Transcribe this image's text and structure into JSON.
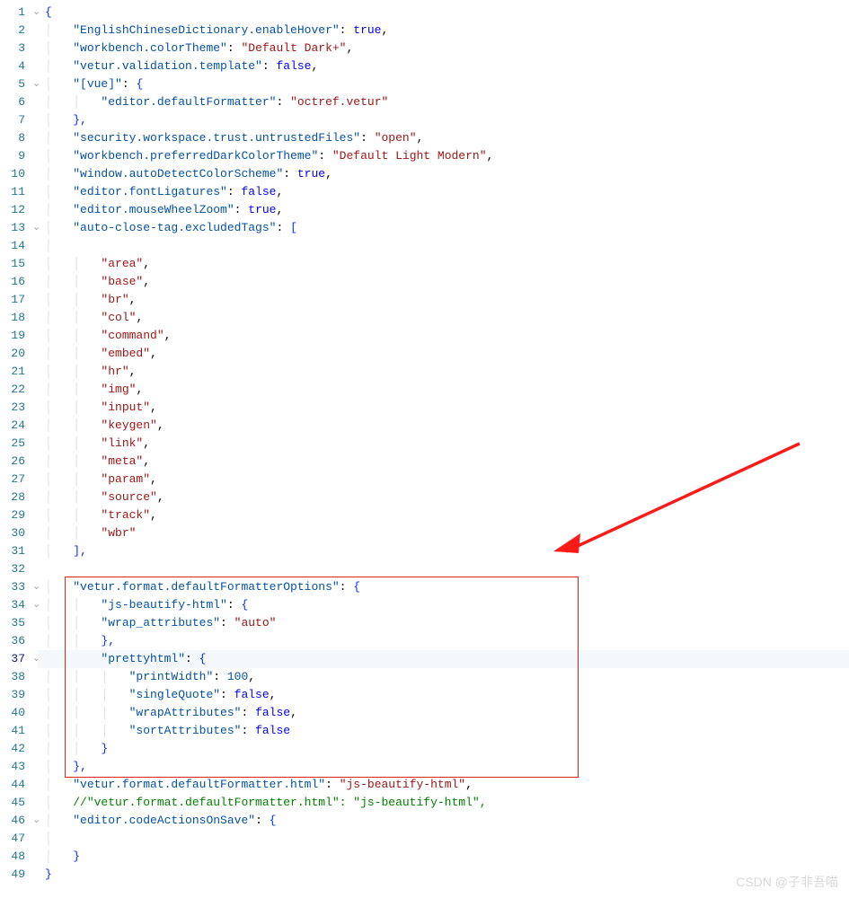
{
  "watermark": "CSDN @子非吾喵",
  "current_line": 37,
  "highlight_box": {
    "startLine": 33,
    "endLine": 43
  },
  "lines": [
    {
      "n": 1,
      "indent": 0,
      "ctype": "brace_open",
      "text": "{"
    },
    {
      "n": 2,
      "indent": 1,
      "ctype": "kv",
      "key": "EnglishChineseDictionary.enableHover",
      "val": "true",
      "vtype": "kw",
      "comma": true
    },
    {
      "n": 3,
      "indent": 1,
      "ctype": "kv",
      "key": "workbench.colorTheme",
      "val": "Default Dark+",
      "vtype": "str",
      "comma": true
    },
    {
      "n": 4,
      "indent": 1,
      "ctype": "kv",
      "key": "vetur.validation.template",
      "val": "false",
      "vtype": "kw",
      "comma": true
    },
    {
      "n": 5,
      "indent": 1,
      "ctype": "kv",
      "key": "[vue]",
      "val": "{",
      "vtype": "brace",
      "comma": false
    },
    {
      "n": 6,
      "indent": 2,
      "ctype": "kv",
      "key": "editor.defaultFormatter",
      "val": "octref.vetur",
      "vtype": "str",
      "comma": false
    },
    {
      "n": 7,
      "indent": 1,
      "ctype": "brace_close",
      "text": "},"
    },
    {
      "n": 8,
      "indent": 1,
      "ctype": "kv",
      "key": "security.workspace.trust.untrustedFiles",
      "val": "open",
      "vtype": "str",
      "comma": true
    },
    {
      "n": 9,
      "indent": 1,
      "ctype": "kv",
      "key": "workbench.preferredDarkColorTheme",
      "val": "Default Light Modern",
      "vtype": "str",
      "comma": true
    },
    {
      "n": 10,
      "indent": 1,
      "ctype": "kv",
      "key": "window.autoDetectColorScheme",
      "val": "true",
      "vtype": "kw",
      "comma": true
    },
    {
      "n": 11,
      "indent": 1,
      "ctype": "kv",
      "key": "editor.fontLigatures",
      "val": "false",
      "vtype": "kw",
      "comma": true
    },
    {
      "n": 12,
      "indent": 1,
      "ctype": "kv",
      "key": "editor.mouseWheelZoom",
      "val": "true",
      "vtype": "kw",
      "comma": true
    },
    {
      "n": 13,
      "indent": 1,
      "ctype": "kv",
      "key": "auto-close-tag.excludedTags",
      "val": "[",
      "vtype": "bracket",
      "comma": false
    },
    {
      "n": 14,
      "indent": 1,
      "ctype": "blank",
      "text": ""
    },
    {
      "n": 15,
      "indent": 2,
      "ctype": "arritem",
      "val": "area",
      "comma": true
    },
    {
      "n": 16,
      "indent": 2,
      "ctype": "arritem",
      "val": "base",
      "comma": true
    },
    {
      "n": 17,
      "indent": 2,
      "ctype": "arritem",
      "val": "br",
      "comma": true
    },
    {
      "n": 18,
      "indent": 2,
      "ctype": "arritem",
      "val": "col",
      "comma": true
    },
    {
      "n": 19,
      "indent": 2,
      "ctype": "arritem",
      "val": "command",
      "comma": true
    },
    {
      "n": 20,
      "indent": 2,
      "ctype": "arritem",
      "val": "embed",
      "comma": true
    },
    {
      "n": 21,
      "indent": 2,
      "ctype": "arritem",
      "val": "hr",
      "comma": true
    },
    {
      "n": 22,
      "indent": 2,
      "ctype": "arritem",
      "val": "img",
      "comma": true
    },
    {
      "n": 23,
      "indent": 2,
      "ctype": "arritem",
      "val": "input",
      "comma": true
    },
    {
      "n": 24,
      "indent": 2,
      "ctype": "arritem",
      "val": "keygen",
      "comma": true
    },
    {
      "n": 25,
      "indent": 2,
      "ctype": "arritem",
      "val": "link",
      "comma": true
    },
    {
      "n": 26,
      "indent": 2,
      "ctype": "arritem",
      "val": "meta",
      "comma": true
    },
    {
      "n": 27,
      "indent": 2,
      "ctype": "arritem",
      "val": "param",
      "comma": true
    },
    {
      "n": 28,
      "indent": 2,
      "ctype": "arritem",
      "val": "source",
      "comma": true
    },
    {
      "n": 29,
      "indent": 2,
      "ctype": "arritem",
      "val": "track",
      "comma": true
    },
    {
      "n": 30,
      "indent": 2,
      "ctype": "arritem",
      "val": "wbr",
      "comma": false
    },
    {
      "n": 31,
      "indent": 1,
      "ctype": "bracket_close",
      "text": "],"
    },
    {
      "n": 32,
      "indent": 0,
      "ctype": "blank",
      "text": ""
    },
    {
      "n": 33,
      "indent": 1,
      "ctype": "kv",
      "key": "vetur.format.defaultFormatterOptions",
      "val": "{",
      "vtype": "brace",
      "comma": false
    },
    {
      "n": 34,
      "indent": 2,
      "ctype": "kv",
      "key": "js-beautify-html",
      "val": "{",
      "vtype": "brace",
      "comma": false
    },
    {
      "n": 35,
      "indent": 2,
      "ctype": "kv",
      "key": "wrap_attributes",
      "val": "auto",
      "vtype": "str",
      "comma": false
    },
    {
      "n": 36,
      "indent": 2,
      "ctype": "brace_close",
      "text": "},"
    },
    {
      "n": 37,
      "indent": 2,
      "ctype": "kv",
      "key": "prettyhtml",
      "val": "{",
      "vtype": "brace",
      "comma": false
    },
    {
      "n": 38,
      "indent": 3,
      "ctype": "kv",
      "key": "printWidth",
      "val": "100",
      "vtype": "num",
      "comma": true
    },
    {
      "n": 39,
      "indent": 3,
      "ctype": "kv",
      "key": "singleQuote",
      "val": "false",
      "vtype": "kw",
      "comma": true
    },
    {
      "n": 40,
      "indent": 3,
      "ctype": "kv",
      "key": "wrapAttributes",
      "val": "false",
      "vtype": "kw",
      "comma": true
    },
    {
      "n": 41,
      "indent": 3,
      "ctype": "kv",
      "key": "sortAttributes",
      "val": "false",
      "vtype": "kw",
      "comma": false
    },
    {
      "n": 42,
      "indent": 2,
      "ctype": "brace_close",
      "text": "}"
    },
    {
      "n": 43,
      "indent": 1,
      "ctype": "brace_close",
      "text": "},"
    },
    {
      "n": 44,
      "indent": 1,
      "ctype": "kv",
      "key": "vetur.format.defaultFormatter.html",
      "val": "js-beautify-html",
      "vtype": "str",
      "comma": true
    },
    {
      "n": 45,
      "indent": 1,
      "ctype": "comment",
      "key": "vetur.format.defaultFormatter.html",
      "val": "js-beautify-html",
      "comma": true
    },
    {
      "n": 46,
      "indent": 1,
      "ctype": "kv",
      "key": "editor.codeActionsOnSave",
      "val": "{",
      "vtype": "brace",
      "comma": false
    },
    {
      "n": 47,
      "indent": 1,
      "ctype": "blank",
      "text": ""
    },
    {
      "n": 48,
      "indent": 1,
      "ctype": "brace_close",
      "text": "}"
    },
    {
      "n": 49,
      "indent": 0,
      "ctype": "brace_close",
      "text": "}"
    }
  ],
  "fold_chevrons": [
    1,
    5,
    13,
    33,
    34,
    37,
    46
  ]
}
